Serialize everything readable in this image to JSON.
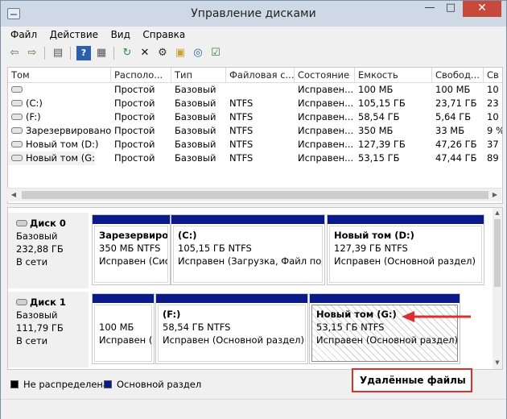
{
  "window": {
    "title": "Управление дисками",
    "minimize": "—",
    "maximize": "□",
    "close": "✕"
  },
  "menu": [
    "Файл",
    "Действие",
    "Вид",
    "Справка"
  ],
  "toolbar": {
    "icons": [
      "back-icon",
      "forward-icon",
      "panel-icon",
      "help-icon",
      "properties-icon",
      "refresh-icon",
      "delete-icon",
      "settings-icon",
      "open-folder-icon",
      "search-disk-icon",
      "check-icon"
    ]
  },
  "volume_table": {
    "columns": [
      "Том",
      "Располо...",
      "Тип",
      "Файловая с...",
      "Состояние",
      "Емкость",
      "Свобод...",
      "Св"
    ],
    "rows": [
      {
        "name": "",
        "layout": "Простой",
        "type": "Базовый",
        "fs": "",
        "status": "Исправен...",
        "capacity": "100 МБ",
        "free": "100 МБ",
        "pct": "10"
      },
      {
        "name": "(C:)",
        "layout": "Простой",
        "type": "Базовый",
        "fs": "NTFS",
        "status": "Исправен...",
        "capacity": "105,15 ГБ",
        "free": "23,71 ГБ",
        "pct": "23"
      },
      {
        "name": "(F:)",
        "layout": "Простой",
        "type": "Базовый",
        "fs": "NTFS",
        "status": "Исправен...",
        "capacity": "58,54 ГБ",
        "free": "5,64 ГБ",
        "pct": "10"
      },
      {
        "name": "Зарезервировано...",
        "layout": "Простой",
        "type": "Базовый",
        "fs": "NTFS",
        "status": "Исправен...",
        "capacity": "350 МБ",
        "free": "33 МБ",
        "pct": "9 %"
      },
      {
        "name": "Новый том (D:)",
        "layout": "Простой",
        "type": "Базовый",
        "fs": "NTFS",
        "status": "Исправен...",
        "capacity": "127,39 ГБ",
        "free": "47,26 ГБ",
        "pct": "37"
      },
      {
        "name": "Новый том (G:)",
        "layout": "Простой",
        "type": "Базовый",
        "fs": "NTFS",
        "status": "Исправен...",
        "capacity": "53,15 ГБ",
        "free": "47,44 ГБ",
        "pct": "89"
      }
    ]
  },
  "disks": [
    {
      "name": "Диск 0",
      "kind": "Базовый",
      "size": "232,88 ГБ",
      "state": "В сети",
      "partitions": [
        {
          "name": "Зарезервиров",
          "size": "350 МБ NTFS",
          "status": "Исправен (Сис"
        },
        {
          "name": "(C:)",
          "size": "105,15 ГБ NTFS",
          "status": "Исправен (Загрузка, Файл подкач"
        },
        {
          "name": "Новый том  (D:)",
          "size": "127,39 ГБ NTFS",
          "status": "Исправен (Основной раздел)"
        }
      ]
    },
    {
      "name": "Диск 1",
      "kind": "Базовый",
      "size": "111,79 ГБ",
      "state": "В сети",
      "partitions": [
        {
          "name": "",
          "size": "100 МБ",
          "status": "Исправен (А"
        },
        {
          "name": "(F:)",
          "size": "58,54 ГБ NTFS",
          "status": "Исправен (Основной раздел)"
        },
        {
          "name": "Новый том  (G:)",
          "size": "53,15 ГБ NTFS",
          "status": "Исправен (Основной раздел)"
        }
      ]
    }
  ],
  "legend": {
    "unallocated": "Не распределена",
    "primary": "Основной раздел",
    "unallocated_color": "#000000",
    "primary_color": "#0b1a8a"
  },
  "annotation": {
    "callout_text": "Удалённые файлы",
    "color": "#d93030"
  }
}
